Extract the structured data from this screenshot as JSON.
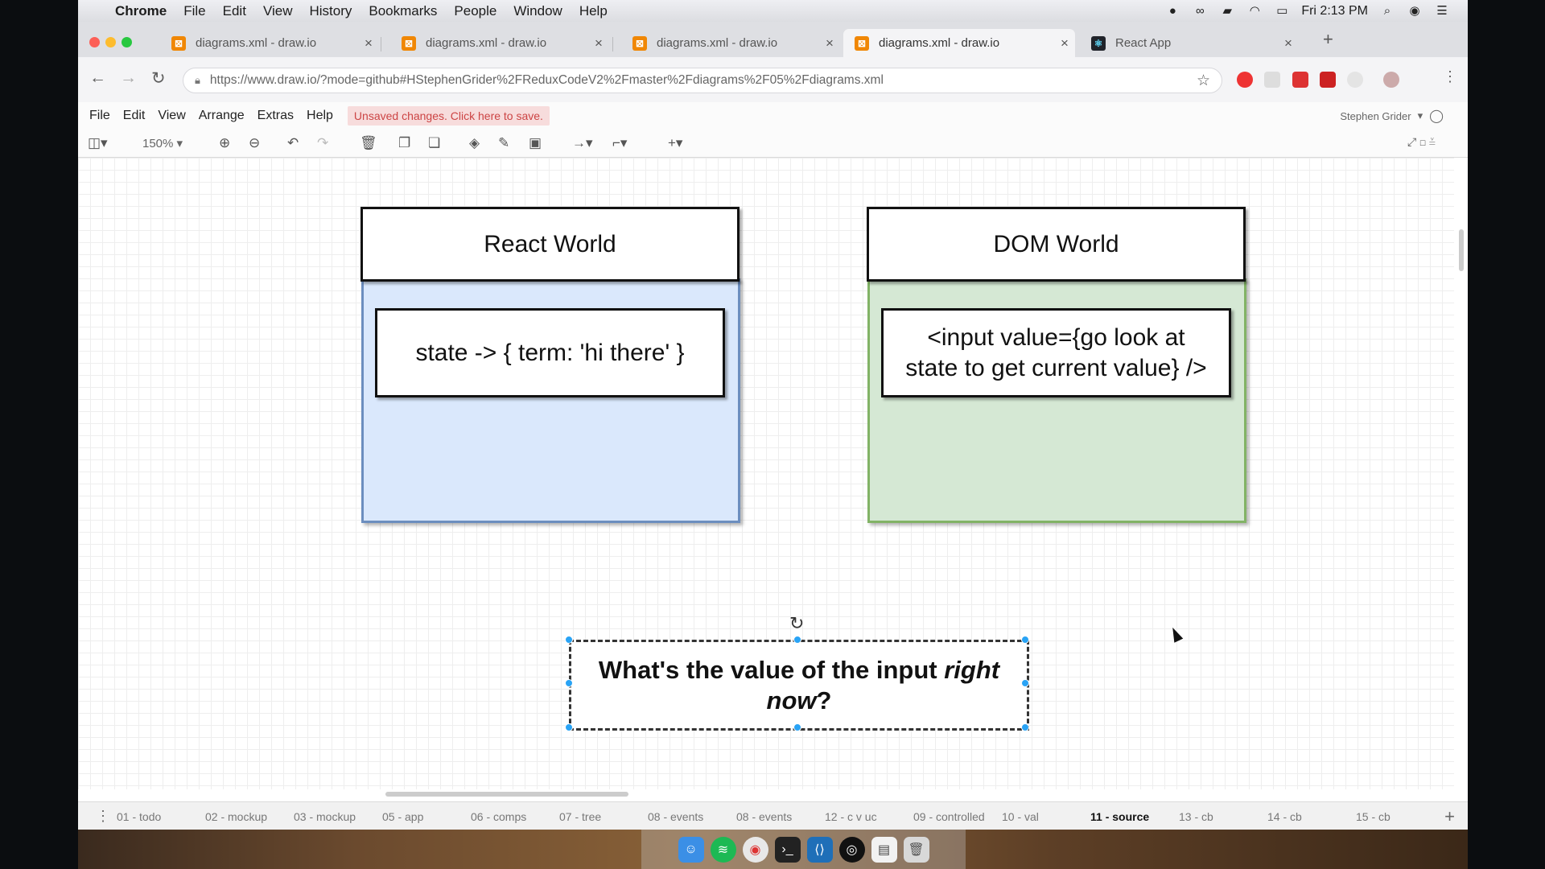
{
  "mac_menubar": {
    "app": "Chrome",
    "items": [
      "File",
      "Edit",
      "View",
      "History",
      "Bookmarks",
      "People",
      "Window",
      "Help"
    ],
    "clock": "Fri 2:13 PM"
  },
  "browser": {
    "tabs": [
      {
        "title": "diagrams.xml - draw.io",
        "active": false,
        "icon": "drawio-icon"
      },
      {
        "title": "diagrams.xml - draw.io",
        "active": false,
        "icon": "drawio-icon"
      },
      {
        "title": "diagrams.xml - draw.io",
        "active": false,
        "icon": "drawio-icon"
      },
      {
        "title": "diagrams.xml - draw.io",
        "active": true,
        "icon": "drawio-icon"
      },
      {
        "title": "React App",
        "active": false,
        "icon": "react-icon"
      }
    ],
    "url": "https://www.draw.io/?mode=github#HStephenGrider%2FReduxCodeV2%2Fmaster%2Fdiagrams%2F05%2Fdiagrams.xml"
  },
  "drawio": {
    "menu": [
      "File",
      "Edit",
      "View",
      "Arrange",
      "Extras",
      "Help"
    ],
    "unsaved": "Unsaved changes. Click here to save.",
    "user": "Stephen Grider",
    "zoom": "150%",
    "diagram": {
      "react_title": "React World",
      "react_state": "state -> { term: 'hi there' }",
      "dom_title": "DOM World",
      "dom_input_line1": "<input value={go look at",
      "dom_input_line2": "state to get current value} />",
      "question_part1": "What's the value of the input ",
      "question_em1": "right",
      "question_em2": "now",
      "question_end": "?"
    },
    "pages": [
      "01 - todo",
      "02 - mockup",
      "03 - mockup",
      "05 - app",
      "06 - comps",
      "07 - tree",
      "08 - events",
      "08 - events",
      "12 - c v uc",
      "09 - controlled",
      "10 - val",
      "11 - source",
      "13 - cb",
      "14 - cb",
      "15 - cb"
    ],
    "active_page": "11 - source"
  },
  "colors": {
    "react_fill": "#dae8fc",
    "react_border": "#6c8ebf",
    "dom_fill": "#d5e8d4",
    "dom_border": "#82b366",
    "selection": "#29a3f5",
    "unsaved_bg": "#f7dcdc"
  }
}
